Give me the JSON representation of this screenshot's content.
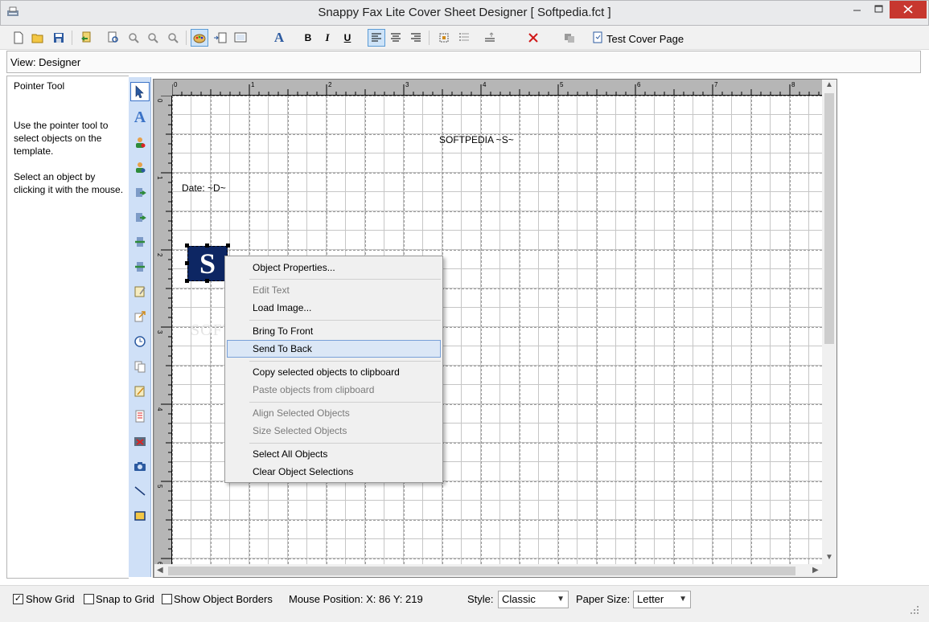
{
  "window": {
    "title": "Snappy Fax Lite Cover Sheet Designer [ Softpedia.fct ]"
  },
  "toolbar": {
    "test_cover_label": "Test Cover Page",
    "icons": [
      "new-icon",
      "open-icon",
      "save-icon",
      "import-icon",
      "print-preview-icon",
      "zoom-in-icon",
      "zoom-out-icon",
      "zoom-fit-icon",
      "palette-icon",
      "page-layout-icon",
      "preview-icon",
      "font-icon",
      "bold-icon",
      "italic-icon",
      "underline-icon",
      "align-left-icon",
      "align-center-icon",
      "align-right-icon",
      "select-all-icon",
      "list-icon",
      "style-icon",
      "delete-icon",
      "copy-icon",
      "test-page-icon"
    ]
  },
  "view_bar": {
    "label": "View: Designer"
  },
  "side_panel": {
    "tool_name": "Pointer Tool",
    "description_1": "Use the pointer tool to select objects on the template.",
    "description_2": "Select an object by clicking it with the mouse."
  },
  "palette": {
    "tools": [
      "pointer-icon",
      "text-icon",
      "recipient-icon",
      "sender-icon",
      "fax-to-icon",
      "fax-from-icon",
      "phone-to-icon",
      "phone-from-icon",
      "notes-icon",
      "subject-icon",
      "clock-icon",
      "pages-icon",
      "comments-icon",
      "checklist-icon",
      "image-icon",
      "camera-icon",
      "line-icon",
      "rectangle-icon"
    ]
  },
  "rulers": {
    "horizontal": [
      "0",
      "1",
      "2",
      "3",
      "4",
      "5",
      "6",
      "7",
      "8"
    ],
    "vertical": [
      "0",
      "1",
      "2",
      "3",
      "4",
      "5",
      "6"
    ]
  },
  "canvas": {
    "softpedia_field": "SOFTPEDIA ~S~",
    "date_field": "Date: ~D~",
    "logo_letter": "S",
    "watermark": "SOFTPEDIA"
  },
  "context_menu": {
    "items": [
      {
        "label": "Object Properties...",
        "disabled": false
      },
      {
        "label": "Edit Text",
        "disabled": true
      },
      {
        "label": "Load Image...",
        "disabled": false
      },
      {
        "label": "Bring To Front",
        "disabled": false
      },
      {
        "label": "Send To Back",
        "disabled": false,
        "highlighted": true
      },
      {
        "label": "Copy selected objects to clipboard",
        "disabled": false
      },
      {
        "label": "Paste objects from clipboard",
        "disabled": true
      },
      {
        "label": "Align Selected Objects",
        "disabled": true
      },
      {
        "label": "Size Selected Objects",
        "disabled": true
      },
      {
        "label": "Select All Objects",
        "disabled": false
      },
      {
        "label": "Clear Object Selections",
        "disabled": false
      }
    ]
  },
  "status_bar": {
    "show_grid": {
      "label": "Show Grid",
      "checked": true
    },
    "snap_to_grid": {
      "label": "Snap to Grid",
      "checked": false
    },
    "show_object_borders": {
      "label": "Show Object Borders",
      "checked": false
    },
    "mouse_position": "Mouse Position: X: 86 Y: 219",
    "style_label": "Style:",
    "style_value": "Classic",
    "paper_size_label": "Paper Size:",
    "paper_size_value": "Letter"
  },
  "colors": {
    "palette_bg": "#cfe0f7",
    "logo_bg": "#0d2663",
    "close_button": "#c7372f",
    "menu_highlight": "#dbe7f6"
  }
}
